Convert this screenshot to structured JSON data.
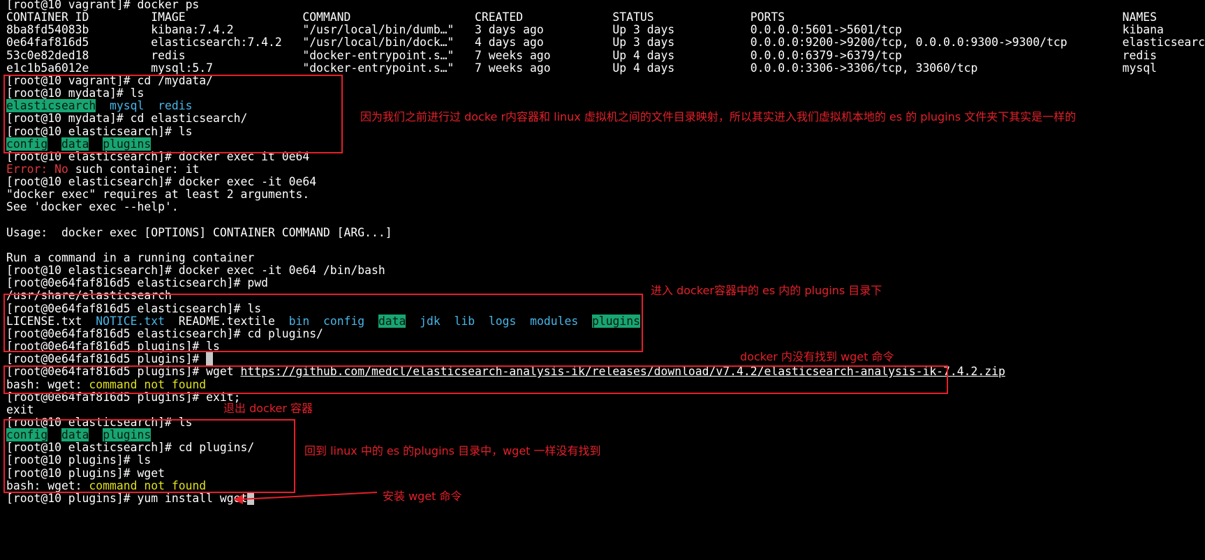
{
  "terminal": {
    "lines": [
      [
        {
          "t": "[root@10 vagrant]# docker ps"
        }
      ],
      [
        {
          "t": "CONTAINER ID         IMAGE                 COMMAND                  CREATED             STATUS              PORTS                                                 NAMES"
        }
      ],
      [
        {
          "t": "8ba8fd54083b         kibana:7.4.2          \"/usr/local/bin/dumb…\"   3 days ago          Up 3 days           0.0.0.0:5601->5601/tcp                                kibana"
        }
      ],
      [
        {
          "t": "0e64faf816d5         elasticsearch:7.4.2   \"/usr/local/bin/dock…\"   4 days ago          Up 3 days           0.0.0.0:9200->9200/tcp, 0.0.0.0:9300->9300/tcp        elasticsearch"
        }
      ],
      [
        {
          "t": "53c0e82ded18         redis                 \"docker-entrypoint.s…\"   7 weeks ago         Up 4 days           0.0.0.0:6379->6379/tcp                                redis"
        }
      ],
      [
        {
          "t": "e1c1b5a6012e         mysql:5.7             \"docker-entrypoint.s…\"   7 weeks ago         Up 4 days           0.0.0.0:3306->3306/tcp, 33060/tcp                     mysql"
        }
      ],
      [
        {
          "t": "[root@10 vagrant]# cd /mydata/"
        }
      ],
      [
        {
          "t": "[root@10 mydata]# ls"
        }
      ],
      [
        {
          "t": "elasticsearch",
          "c": "hl"
        },
        {
          "t": "  "
        },
        {
          "t": "mysql",
          "c": "dir"
        },
        {
          "t": "  "
        },
        {
          "t": "redis",
          "c": "dir"
        }
      ],
      [
        {
          "t": "[root@10 mydata]# cd elasticsearch/"
        }
      ],
      [
        {
          "t": "[root@10 elasticsearch]# ls"
        }
      ],
      [
        {
          "t": "config",
          "c": "hl"
        },
        {
          "t": "  "
        },
        {
          "t": "data",
          "c": "hl"
        },
        {
          "t": "  "
        },
        {
          "t": "plugins",
          "c": "hl"
        }
      ],
      [
        {
          "t": "[root@10 elasticsearch]# docker exec it 0e64"
        }
      ],
      [
        {
          "t": "Error: ",
          "c": "err"
        },
        {
          "t": "No",
          "c": "err"
        },
        {
          "t": " such container: it"
        }
      ],
      [
        {
          "t": "[root@10 elasticsearch]# docker exec -it 0e64"
        }
      ],
      [
        {
          "t": "\"docker exec\" requires at least 2 arguments."
        }
      ],
      [
        {
          "t": "See 'docker exec --help'."
        }
      ],
      [
        {
          "t": ""
        }
      ],
      [
        {
          "t": "Usage:  docker exec [OPTIONS] CONTAINER COMMAND [ARG...]"
        }
      ],
      [
        {
          "t": ""
        }
      ],
      [
        {
          "t": "Run a command in a running container"
        }
      ],
      [
        {
          "t": "[root@10 elasticsearch]# docker exec -it 0e64 /bin/bash"
        }
      ],
      [
        {
          "t": "[root@0e64faf816d5 elasticsearch]# pwd"
        }
      ],
      [
        {
          "t": "/usr/share/elasticsearch"
        }
      ],
      [
        {
          "t": "[root@0e64faf816d5 elasticsearch]# ls"
        }
      ],
      [
        {
          "t": "LICENSE.txt  "
        },
        {
          "t": "NOTICE.txt",
          "c": "dir"
        },
        {
          "t": "  README.textile  "
        },
        {
          "t": "bin",
          "c": "dir"
        },
        {
          "t": "  "
        },
        {
          "t": "config",
          "c": "dir"
        },
        {
          "t": "  "
        },
        {
          "t": "data",
          "c": "hl"
        },
        {
          "t": "  "
        },
        {
          "t": "jdk",
          "c": "dir"
        },
        {
          "t": "  "
        },
        {
          "t": "lib",
          "c": "dir"
        },
        {
          "t": "  "
        },
        {
          "t": "logs",
          "c": "dir"
        },
        {
          "t": "  "
        },
        {
          "t": "modules",
          "c": "dir"
        },
        {
          "t": "  "
        },
        {
          "t": "plugins",
          "c": "hl"
        }
      ],
      [
        {
          "t": "[root@0e64faf816d5 elasticsearch]# cd plugins/"
        }
      ],
      [
        {
          "t": "[root@0e64faf816d5 plugins]# ls"
        }
      ],
      [
        {
          "t": "[root@0e64faf816d5 plugins]# "
        },
        {
          "t": " ",
          "c": "cursor"
        }
      ],
      [
        {
          "t": "[root@0e64faf816d5 plugins]# wget "
        },
        {
          "t": "https://github.com/medcl/elasticsearch-analysis-ik/releases/download/v7.4.2/elasticsearch-analysis-ik-7.4.2.zip",
          "c": "url"
        }
      ],
      [
        {
          "t": "bash: wget: "
        },
        {
          "t": "command not found",
          "c": "warn"
        }
      ],
      [
        {
          "t": "[root@0e64faf816d5 plugins]# exit;"
        }
      ],
      [
        {
          "t": "exit"
        }
      ],
      [
        {
          "t": "[root@10 elasticsearch]# ls"
        }
      ],
      [
        {
          "t": "config",
          "c": "hl"
        },
        {
          "t": "  "
        },
        {
          "t": "data",
          "c": "hl"
        },
        {
          "t": "  "
        },
        {
          "t": "plugins",
          "c": "hl"
        }
      ],
      [
        {
          "t": "[root@10 elasticsearch]# cd plugins/"
        }
      ],
      [
        {
          "t": "[root@10 plugins]# ls"
        }
      ],
      [
        {
          "t": "[root@10 plugins]# wget"
        }
      ],
      [
        {
          "t": "bash: wget: "
        },
        {
          "t": "command not found",
          "c": "warn"
        }
      ],
      [
        {
          "t": "[root@10 plugins]# yum install wget"
        },
        {
          "t": " ",
          "c": "cursor"
        }
      ]
    ]
  },
  "annotations": [
    {
      "id": "note-mydata",
      "text": "因为我们之前进行过 docke r内容器和 linux 虚拟机之间的文件目录映射，所以其实进入我们虚拟机本地的 es 的 plugins 文件夹下其实是一样的"
    },
    {
      "id": "note-enter-docker",
      "text": "进入 docker容器中的 es 内的 plugins 目录下"
    },
    {
      "id": "note-no-wget",
      "text": "docker 内没有找到 wget 命令"
    },
    {
      "id": "note-exit",
      "text": "退出 docker 容器"
    },
    {
      "id": "note-back-linux",
      "text": "回到 linux 中的 es 的plugins 目录中，wget 一样没有找到"
    },
    {
      "id": "note-install",
      "text": "安装 wget 命令"
    }
  ],
  "colors": {
    "background": "#000000",
    "text": "#ffffff",
    "directory": "#48b5e8",
    "highlight_bg": "#17a673",
    "error": "#e0383e",
    "warning": "#e0e020",
    "annotation": "#e5202a"
  }
}
